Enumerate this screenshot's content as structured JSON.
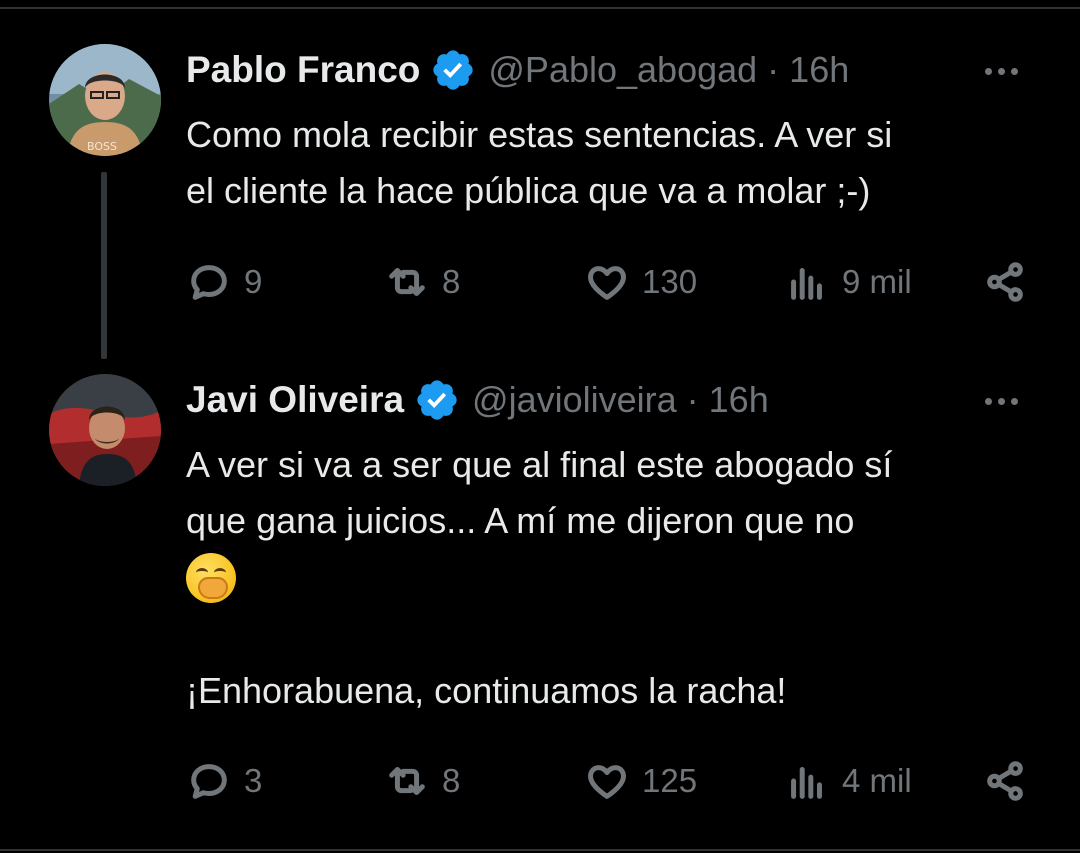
{
  "colors": {
    "background": "#000000",
    "text_primary": "#e7e9ea",
    "text_secondary": "#71767b",
    "verified_blue": "#1d9bf0",
    "divider": "#2f3336"
  },
  "tweets": [
    {
      "name": "Pablo Franco",
      "handle": "@Pablo_abogad",
      "separator": "·",
      "time": "16h",
      "verified": true,
      "text_lines": [
        "Como mola recibir estas sentencias. A ver si",
        "el cliente la hace pública que va a molar ;-)"
      ],
      "replies": "9",
      "retweets": "8",
      "likes": "130",
      "views": "9 mil"
    },
    {
      "name": "Javi Oliveira",
      "handle": "@javioliveira",
      "separator": "·",
      "time": "16h",
      "verified": true,
      "text_lines": [
        "A ver si va a ser que al final este abogado sí",
        "que gana juicios... A mí me dijeron que no",
        "",
        "¡Enhorabuena, continuamos la racha!"
      ],
      "emoji": "face-with-hand-over-mouth",
      "replies": "3",
      "retweets": "8",
      "likes": "125",
      "views": "4 mil"
    }
  ]
}
